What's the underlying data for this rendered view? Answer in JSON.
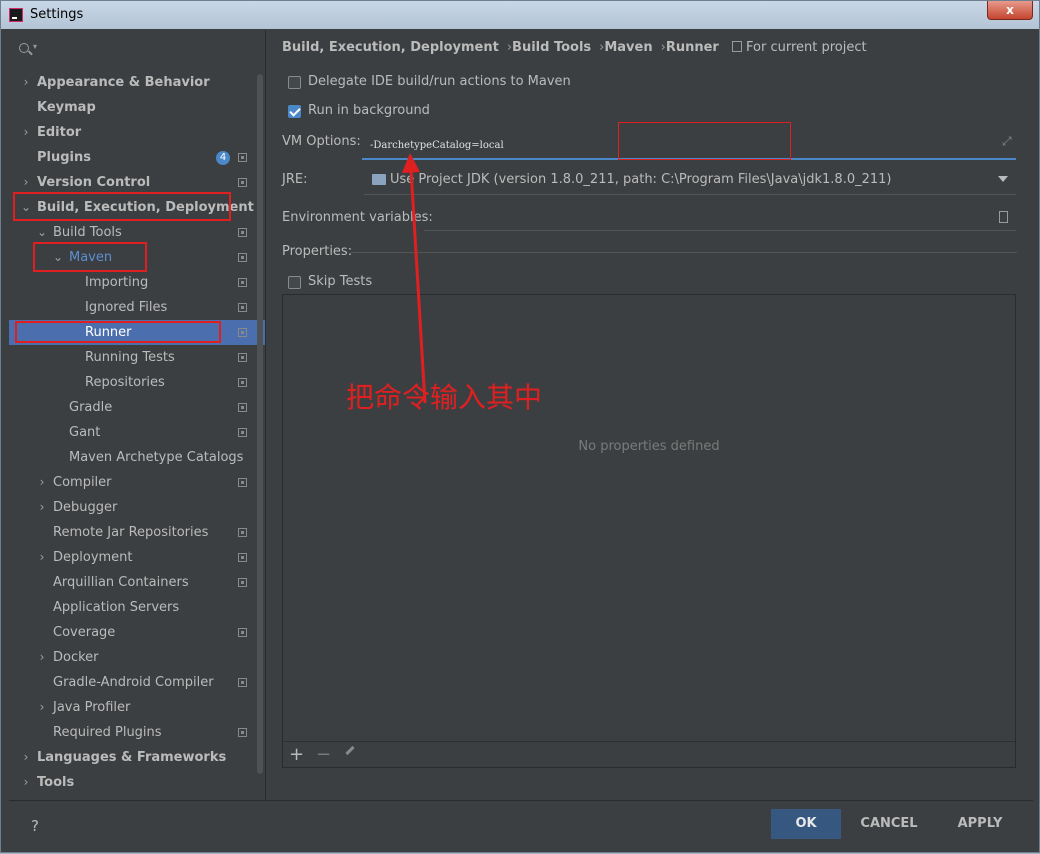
{
  "window": {
    "title": "Settings",
    "close_label": "x"
  },
  "search": {
    "placeholder": ""
  },
  "tree": [
    {
      "label": "Appearance & Behavior",
      "level": 0,
      "arrow": "›",
      "bold": true,
      "proj": false
    },
    {
      "label": "Keymap",
      "level": 0,
      "arrow": "",
      "bold": true,
      "proj": false
    },
    {
      "label": "Editor",
      "level": 0,
      "arrow": "›",
      "bold": true,
      "proj": false
    },
    {
      "label": "Plugins",
      "level": 0,
      "arrow": "",
      "bold": true,
      "proj": true,
      "badge": "4"
    },
    {
      "label": "Version Control",
      "level": 0,
      "arrow": "›",
      "bold": true,
      "proj": true
    },
    {
      "label": "Build, Execution, Deployment",
      "level": 0,
      "arrow": "⌄",
      "bold": true,
      "proj": false
    },
    {
      "label": "Build Tools",
      "level": 1,
      "arrow": "⌄",
      "bold": false,
      "proj": true
    },
    {
      "label": "Maven",
      "level": 2,
      "arrow": "⌄",
      "bold": false,
      "proj": true,
      "highlight": true
    },
    {
      "label": "Importing",
      "level": 3,
      "arrow": "",
      "bold": false,
      "proj": true
    },
    {
      "label": "Ignored Files",
      "level": 3,
      "arrow": "",
      "bold": false,
      "proj": true
    },
    {
      "label": "Runner",
      "level": 3,
      "arrow": "",
      "bold": false,
      "proj": true,
      "selected": true
    },
    {
      "label": "Running Tests",
      "level": 3,
      "arrow": "",
      "bold": false,
      "proj": true
    },
    {
      "label": "Repositories",
      "level": 3,
      "arrow": "",
      "bold": false,
      "proj": true
    },
    {
      "label": "Gradle",
      "level": 2,
      "arrow": "",
      "bold": false,
      "proj": true
    },
    {
      "label": "Gant",
      "level": 2,
      "arrow": "",
      "bold": false,
      "proj": true
    },
    {
      "label": "Maven Archetype Catalogs",
      "level": 2,
      "arrow": "",
      "bold": false,
      "proj": false
    },
    {
      "label": "Compiler",
      "level": 1,
      "arrow": "›",
      "bold": false,
      "proj": true
    },
    {
      "label": "Debugger",
      "level": 1,
      "arrow": "›",
      "bold": false,
      "proj": false
    },
    {
      "label": "Remote Jar Repositories",
      "level": 1,
      "arrow": "",
      "bold": false,
      "proj": true
    },
    {
      "label": "Deployment",
      "level": 1,
      "arrow": "›",
      "bold": false,
      "proj": true
    },
    {
      "label": "Arquillian Containers",
      "level": 1,
      "arrow": "",
      "bold": false,
      "proj": true
    },
    {
      "label": "Application Servers",
      "level": 1,
      "arrow": "",
      "bold": false,
      "proj": false
    },
    {
      "label": "Coverage",
      "level": 1,
      "arrow": "",
      "bold": false,
      "proj": true
    },
    {
      "label": "Docker",
      "level": 1,
      "arrow": "›",
      "bold": false,
      "proj": false
    },
    {
      "label": "Gradle-Android Compiler",
      "level": 1,
      "arrow": "",
      "bold": false,
      "proj": true
    },
    {
      "label": "Java Profiler",
      "level": 1,
      "arrow": "›",
      "bold": false,
      "proj": false
    },
    {
      "label": "Required Plugins",
      "level": 1,
      "arrow": "",
      "bold": false,
      "proj": true
    },
    {
      "label": "Languages & Frameworks",
      "level": 0,
      "arrow": "›",
      "bold": true,
      "proj": false
    },
    {
      "label": "Tools",
      "level": 0,
      "arrow": "›",
      "bold": true,
      "proj": false
    }
  ],
  "breadcrumb": {
    "items": [
      "Build, Execution, Deployment",
      "Build Tools",
      "Maven",
      "Runner"
    ],
    "separator": "›",
    "scope": "For current project"
  },
  "runner": {
    "delegate_label": "Delegate IDE build/run actions to Maven",
    "delegate_checked": false,
    "background_label": "Run in background",
    "background_checked": true,
    "vm_label": "VM Options:",
    "vm_value": "-DarchetypeCatalog=local",
    "jre_label": "JRE:",
    "jre_value": "Use Project JDK (version 1.8.0_211, path: C:\\Program Files\\Java\\jdk1.8.0_211)",
    "env_label": "Environment variables:",
    "properties_label": "Properties:",
    "skip_tests_label": "Skip Tests",
    "skip_tests_checked": false,
    "no_properties": "No properties defined",
    "add_label": "+",
    "remove_label": "−"
  },
  "annotation": {
    "text": "把命令输入其中",
    "color": "#e02020"
  },
  "footer": {
    "help_label": "?",
    "ok_label": "OK",
    "cancel_label": "CANCEL",
    "apply_label": "APPLY"
  },
  "colors": {
    "accent": "#4a88c7",
    "selection": "#4b6eaf",
    "primary_button": "#365880",
    "background": "#3c3f41"
  }
}
